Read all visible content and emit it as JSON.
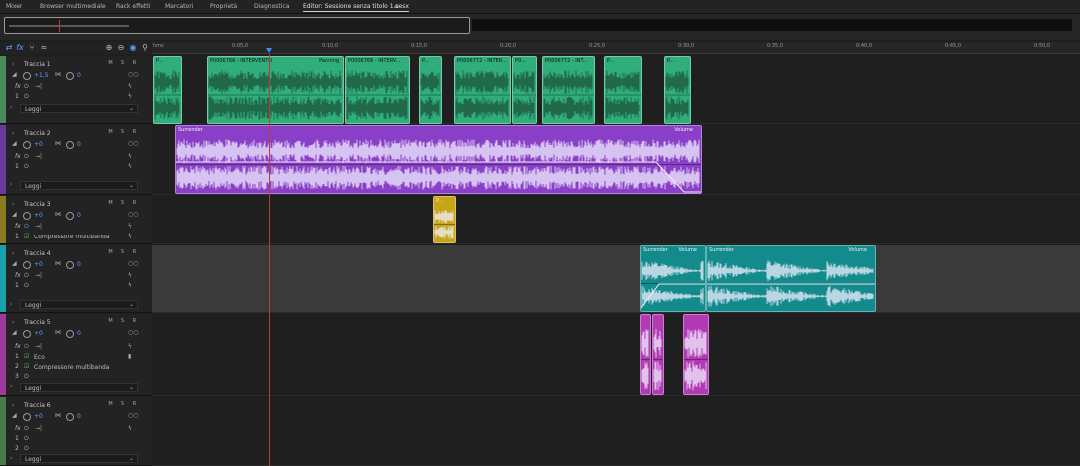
{
  "tabs": [
    {
      "label": "Mixer"
    },
    {
      "label": "Browser multimediale"
    },
    {
      "label": "Rack effetti"
    },
    {
      "label": "Marcatori"
    },
    {
      "label": "Proprietà"
    },
    {
      "label": "Diagnostica"
    },
    {
      "label": "Editor: Sessione senza titolo 1.sesx"
    }
  ],
  "ruler": {
    "labels": [
      "hms",
      "0:05,0",
      "0:10,0",
      "0:15,0",
      "0:20,0",
      "0:25,0",
      "0:30,0",
      "0:35,0",
      "0:40,0",
      "0:45,0",
      "0:50,0"
    ]
  },
  "tracks": [
    {
      "name": "Traccia 1",
      "volume": "+1,5",
      "pan": "0",
      "read": "Leggi",
      "color": "#4a8a5a"
    },
    {
      "name": "Traccia 2",
      "volume": "+0",
      "pan": "0",
      "read": "Leggi",
      "color": "#6a3a9a"
    },
    {
      "name": "Traccia 3",
      "volume": "+0",
      "pan": "0",
      "read": "Leggi",
      "color": "#8a7a20",
      "fx_cut": "Compressore multibanda"
    },
    {
      "name": "Traccia 4",
      "volume": "+0",
      "pan": "0",
      "read": "Leggi",
      "color": "#1aa0a8"
    },
    {
      "name": "Traccia 5",
      "volume": "+0",
      "pan": "0",
      "read": "Leggi",
      "color": "#a03a9a",
      "fx1": "Eco",
      "fx2": "Compressore multibanda"
    },
    {
      "name": "Traccia 6",
      "volume": "+0",
      "pan": "0",
      "read": "Leggi",
      "color": "#4a7a4a"
    }
  ],
  "fx_label": "fx",
  "slot_numbers": [
    "1",
    "2",
    "3"
  ],
  "msr": [
    "M",
    "S",
    "R"
  ],
  "clips": {
    "t1": [
      {
        "title": "P..."
      },
      {
        "title": "P0006766 - INTERVENTO",
        "extra": "Panning"
      },
      {
        "title": "P0006766 - INTERV..."
      },
      {
        "title": "P..."
      },
      {
        "title": "P0006772 - INTER..."
      },
      {
        "title": "P0..."
      },
      {
        "title": "P0006772 - INT..."
      },
      {
        "title": "P..."
      },
      {
        "title": "P..."
      }
    ],
    "t2": {
      "title": "Surrender",
      "extra": "Volume"
    },
    "t3": {
      "title": "P..."
    },
    "t4a": {
      "title": "Surrender",
      "extra": "Volume"
    },
    "t4b": {
      "title": "Surrender",
      "extra": "Volume"
    }
  },
  "colors": {
    "green": "#2fae7c",
    "purple": "#8a3fc8",
    "yellow": "#c8a418",
    "teal": "#138a8c",
    "magenta": "#b23ab4"
  }
}
